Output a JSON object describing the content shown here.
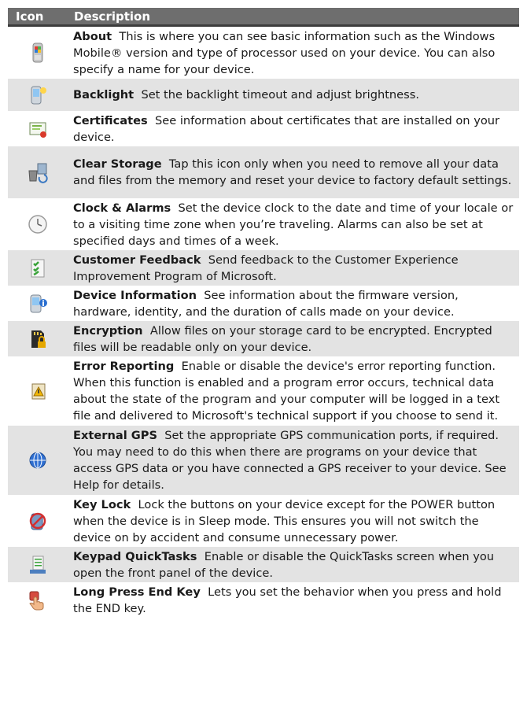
{
  "header": {
    "icon": "Icon",
    "description": "Description"
  },
  "rows": [
    {
      "icon": "phone-windows-logo-icon",
      "title": "About",
      "text": "This is where you can see basic information such as the Windows Mobile® version and type of processor used on your device. You can also specify a name for your device."
    },
    {
      "icon": "backlight-phone-icon",
      "title": "Backlight",
      "text": "Set the backlight timeout and adjust brightness."
    },
    {
      "icon": "certificate-icon",
      "title": "Certificates",
      "text": "See information about certificates that are installed on your device."
    },
    {
      "icon": "clear-storage-icon",
      "title": "Clear Storage",
      "text": "Tap this icon only when you need to remove all your data and files from the memory and reset your device to factory default settings."
    },
    {
      "icon": "clock-icon",
      "title": "Clock & Alarms",
      "text": "Set the device clock to the date and time of your locale or to a visiting time zone when you’re traveling. Alarms can also be set at specified days and times of a week."
    },
    {
      "icon": "checklist-icon",
      "title": "Customer Feedback",
      "text": "Send feedback to the Customer Experience Improvement Program of Microsoft."
    },
    {
      "icon": "device-info-icon",
      "title": "Device Information",
      "text": "See information about the firmware version, hardware, identity, and the duration of calls made on your device."
    },
    {
      "icon": "encrypted-card-icon",
      "title": "Encryption",
      "text": "Allow files on your storage card to be encrypted. Encrypted files will be readable only on your device."
    },
    {
      "icon": "error-report-icon",
      "title": "Error Reporting",
      "text": "Enable or disable the device's error reporting function. When this function is enabled and a program error occurs, technical data about the state of the program and your computer will be logged in a text file and delivered to Microsoft's technical support if you choose to send it."
    },
    {
      "icon": "gps-globe-icon",
      "title": "External GPS",
      "text": "Set the appropriate GPS communication ports, if required. You may need to do this when there are programs on your device that access GPS data or you have connected a GPS receiver to your device. See Help for details."
    },
    {
      "icon": "key-lock-icon",
      "title": "Key Lock",
      "text": "Lock the buttons on your device except for the POWER button when the device is in Sleep mode. This ensures you will not switch the device on by accident and consume unnecessary power."
    },
    {
      "icon": "keypad-quicktasks-icon",
      "title": "Keypad QuickTasks",
      "text": "Enable or disable the QuickTasks screen when you open the front panel of the device."
    },
    {
      "icon": "long-press-hand-icon",
      "title": "Long Press End Key",
      "text": "Lets you set the behavior when you press and hold the END key."
    }
  ]
}
